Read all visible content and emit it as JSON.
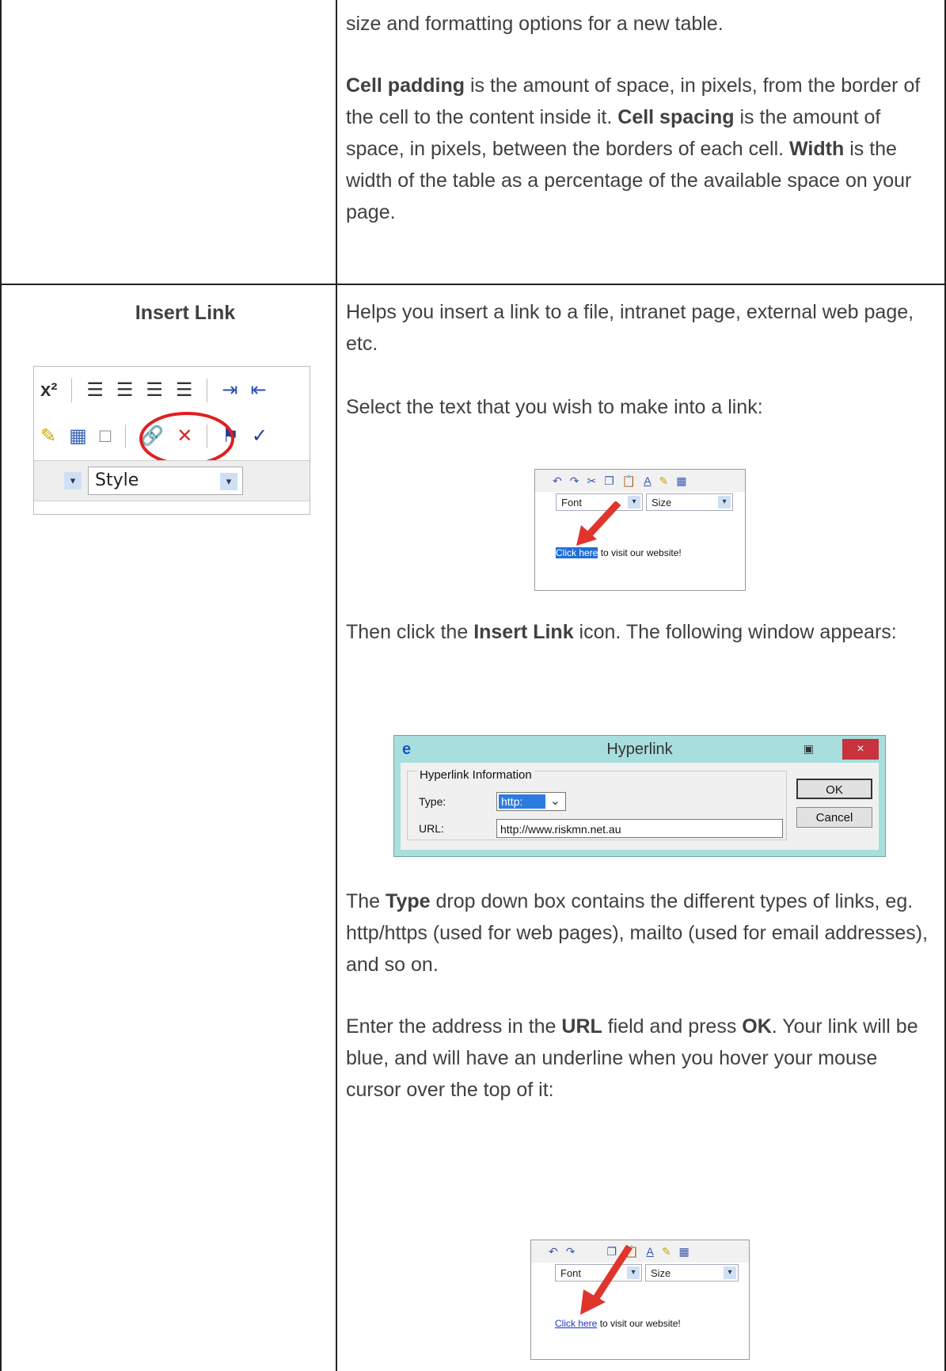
{
  "top_row": {
    "line1": "size and formatting options for a new table.",
    "padding_term": "Cell padding",
    "padding_text": " is the amount of space, in pixels, from the border of the cell to the content inside it. ",
    "spacing_term": "Cell spacing",
    "spacing_text": " is the amount of space, in pixels, between the borders of each cell. ",
    "width_term": "Width",
    "width_text": " is the width of the table as a percentage of the available space on your page."
  },
  "insert_link": {
    "heading": "Insert Link",
    "intro": "Helps you insert a link to a file, intranet page, external web page, etc.",
    "select_text": "Select the text that you wish to make into a link:",
    "then_a": "Then click the ",
    "then_term": "Insert Link",
    "then_b": " icon. The following window appears:",
    "type_a": "The ",
    "type_term": "Type",
    "type_b": " drop down box contains the different types of links, eg. http/https (used for web pages), mailto (used for email addresses), and so on.",
    "enter_a": "Enter the address in the ",
    "enter_url": "URL",
    "enter_b": " field and press ",
    "enter_ok": "OK",
    "enter_c": ". Your link will be blue, and will have an underline when you hover your mouse cursor over the top of it:"
  },
  "toolbar_crop": {
    "style_label": "Style"
  },
  "editor_shot": {
    "font_label": "Font",
    "size_label": "Size",
    "link_text": "Click here",
    "rest_text": " to visit our website!"
  },
  "dialog": {
    "title": "Hyperlink",
    "group_label": "Hyperlink Information",
    "type_label": "Type:",
    "type_value": "http:",
    "url_label": "URL:",
    "url_value": "http://www.riskmn.net.au",
    "ok_label": "OK",
    "cancel_label": "Cancel",
    "close_glyph": "×"
  }
}
